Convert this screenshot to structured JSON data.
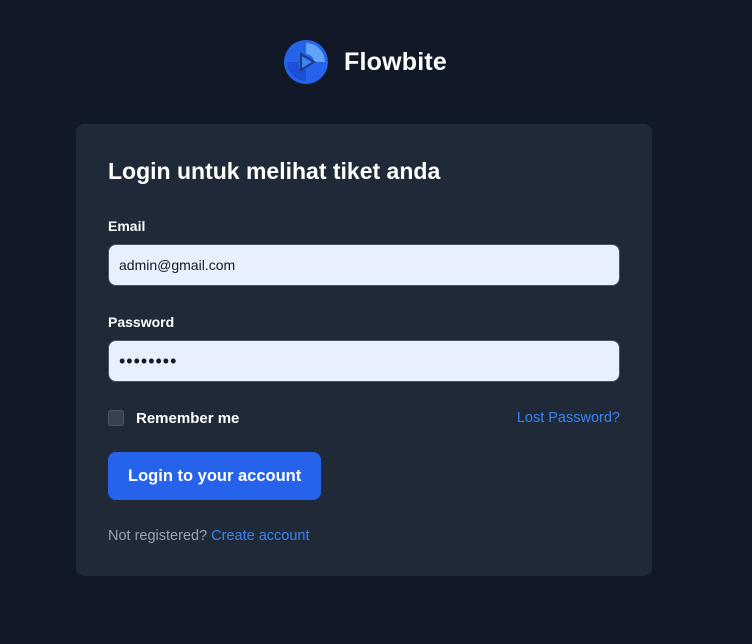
{
  "brand": {
    "name": "Flowbite",
    "logo_icon": "flowbite-logo-icon"
  },
  "login_form": {
    "title": "Login untuk melihat tiket anda",
    "email": {
      "label": "Email",
      "value": "admin@gmail.com"
    },
    "password": {
      "label": "Password",
      "masked_value": "••••••••"
    },
    "remember_me": {
      "label": "Remember me",
      "checked": false
    },
    "lost_password_link": "Lost Password?",
    "submit_label": "Login to your account",
    "register_prompt": "Not registered?",
    "create_account_link": "Create account"
  },
  "colors": {
    "page_background": "#111827",
    "card_background": "#1f2937",
    "input_background": "#e8f0fe",
    "accent": "#2563eb",
    "link": "#3b82f6",
    "muted_text": "#9ca3af"
  }
}
